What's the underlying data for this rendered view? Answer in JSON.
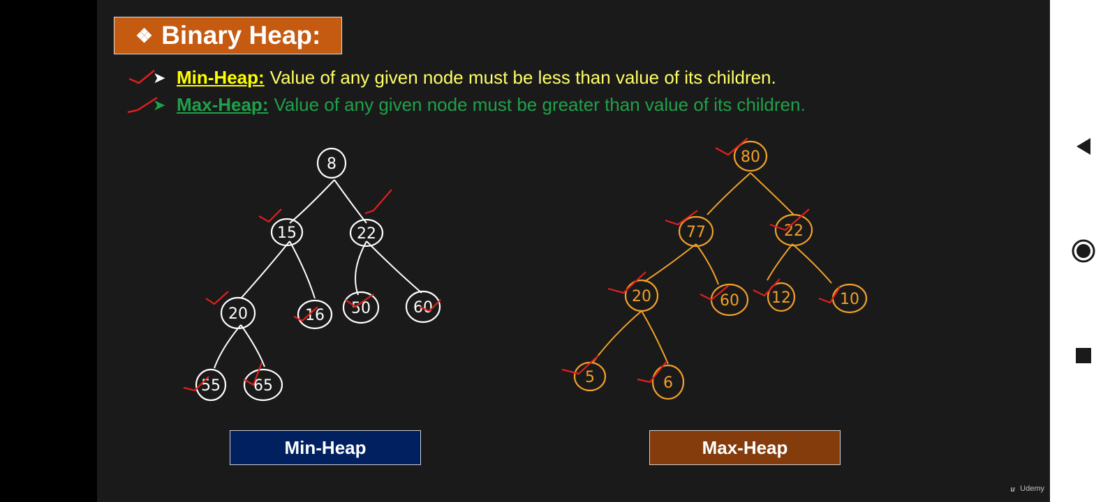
{
  "slide": {
    "title_icon": "diamond-bullet-icon",
    "title": "Binary Heap:",
    "bullets": [
      {
        "term": "Min-Heap:",
        "text": "Value of any given node must be less than value of its children."
      },
      {
        "term": "Max-Heap:",
        "text": "Value of any given node must be greater than value of its children."
      }
    ],
    "min_heap": {
      "caption": "Min-Heap",
      "nodes": [
        "8",
        "15",
        "22",
        "20",
        "16",
        "50",
        "60",
        "55",
        "65"
      ],
      "ink": "#ffffff"
    },
    "max_heap": {
      "caption": "Max-Heap",
      "nodes": [
        "80",
        "77",
        "22",
        "20",
        "60",
        "12",
        "10",
        "5",
        "6"
      ],
      "ink": "#f2a12a"
    },
    "check_color": "#e0201c",
    "watermark": "Udemy",
    "watermark_logo": "udemy-logo-icon"
  },
  "nav": {
    "back_icon": "back-triangle-icon",
    "home_icon": "home-circle-icon",
    "recents_icon": "recents-square-icon"
  }
}
